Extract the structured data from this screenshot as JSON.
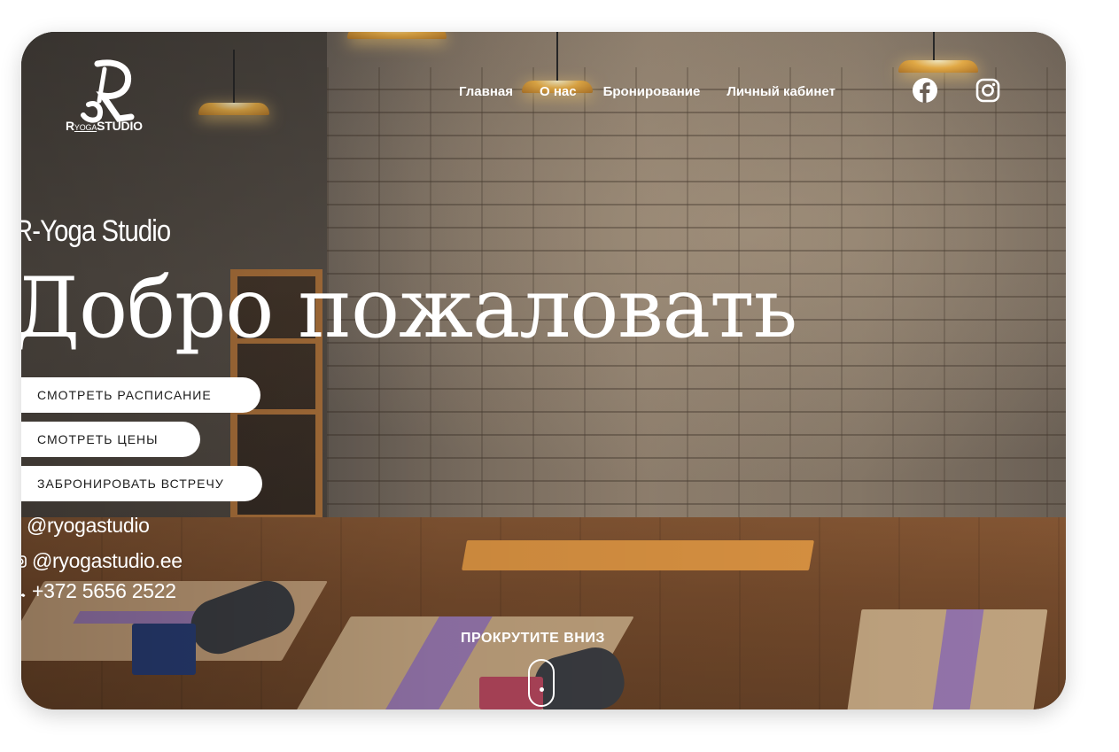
{
  "logo": {
    "name": "ryoga-studio-logo",
    "text_main": "R",
    "text_small": "YOGA",
    "text_studio": "STUDIO"
  },
  "nav": {
    "items": [
      {
        "label": "Главная"
      },
      {
        "label": "О нас"
      },
      {
        "label": "Бронирование"
      },
      {
        "label": "Личный кабинет"
      }
    ]
  },
  "social": {
    "facebook_icon": "facebook-icon",
    "instagram_icon": "instagram-icon"
  },
  "hero": {
    "brand": "R-Yoga Studio",
    "headline": "Добро пожаловать",
    "buttons": [
      {
        "label": "СМОТРЕТЬ РАСПИСАНИЕ"
      },
      {
        "label": "СМОТРЕТЬ ЦЕНЫ"
      },
      {
        "label": "ЗАБРОНИРОВАТЬ ВСТРЕЧУ"
      }
    ]
  },
  "contacts": {
    "facebook": "@ryogastudio",
    "instagram": "@ryogastudio.ee",
    "phone": "+372 5656 2522"
  },
  "scroll": {
    "label": "ПРОКРУТИТЕ ВНИЗ"
  },
  "colors": {
    "text": "#ffffff",
    "button_bg": "#ffffff",
    "button_text": "#1c1c1c"
  }
}
